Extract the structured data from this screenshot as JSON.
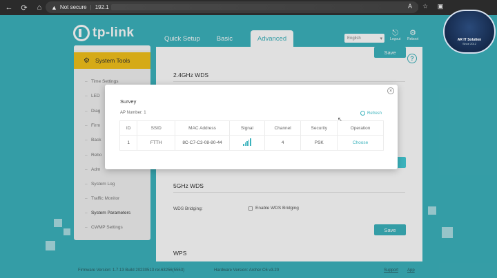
{
  "browser": {
    "security_label": "Not secure",
    "url": "192.1"
  },
  "badge": {
    "line1": "AR IT Solution",
    "line2": "Since 2012"
  },
  "header": {
    "logo_text": "tp-link",
    "tabs": [
      {
        "label": "Quick Setup"
      },
      {
        "label": "Basic"
      },
      {
        "label": "Advanced"
      }
    ],
    "language": "English",
    "logout_label": "Logout",
    "reboot_label": "Reboot"
  },
  "sidebar": {
    "active": "System Tools",
    "items": [
      {
        "label": "Time Settings"
      },
      {
        "label": "LED"
      },
      {
        "label": "Diag"
      },
      {
        "label": "Firm"
      },
      {
        "label": "Back"
      },
      {
        "label": "Rebo"
      },
      {
        "label": "Adm"
      },
      {
        "label": "System Log"
      },
      {
        "label": "Traffic Monitor"
      },
      {
        "label": "System Parameters"
      },
      {
        "label": "CWMP Settings"
      }
    ]
  },
  "main": {
    "save_label": "Save",
    "section_24": "2.4GHz WDS",
    "section_5": "5GHz WDS",
    "wds_bridging_label": "WDS Bridging:",
    "enable_wds_label": "Enable WDS Bridging",
    "save_label_2": "Save",
    "section_wps": "WPS"
  },
  "modal": {
    "title": "Survey",
    "ap_number": "AP Number: 1",
    "refresh_label": "Refresh",
    "columns": [
      "ID",
      "SSID",
      "MAC Address",
      "Signal",
      "Channel",
      "Security",
      "Operation"
    ],
    "rows": [
      {
        "id": "1",
        "ssid": "FTTH",
        "mac": "8C-C7-C3-08-80-44",
        "signal_bars": 5,
        "channel": "4",
        "security": "PSK",
        "operation": "Choose"
      }
    ]
  },
  "footer": {
    "firmware": "Firmware Version: 1.7.13 Build 20230513 rel.63256(5553)",
    "hardware": "Hardware Version: Archer C6 v3.20",
    "support": "Support",
    "app": "App"
  },
  "colors": {
    "brand_teal": "#3cb3bd",
    "active_yellow": "#f3c21b"
  }
}
